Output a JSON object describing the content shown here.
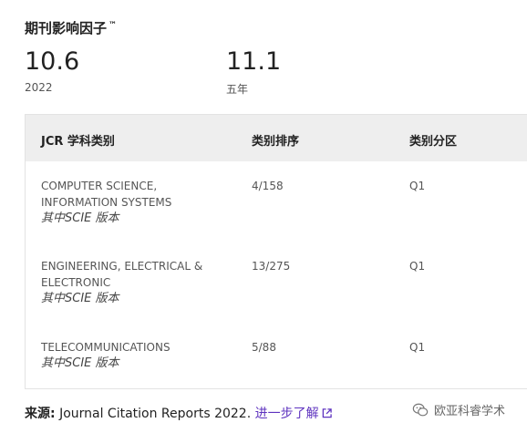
{
  "header": {
    "title": "期刊影响因子",
    "trademark": "™"
  },
  "metrics": [
    {
      "value": "10.6",
      "label": "2022"
    },
    {
      "value": "11.1",
      "label": "五年"
    }
  ],
  "table": {
    "columns": [
      "JCR 学科类别",
      "类别排序",
      "类别分区"
    ],
    "rows": [
      {
        "category_line1": "COMPUTER SCIENCE,",
        "category_line2": "INFORMATION SYSTEMS",
        "edition": "其中SCIE 版本",
        "rank": "4/158",
        "quartile": "Q1"
      },
      {
        "category_line1": "ENGINEERING, ELECTRICAL &",
        "category_line2": "ELECTRONIC",
        "edition": "其中SCIE 版本",
        "rank": "13/275",
        "quartile": "Q1"
      },
      {
        "category_line1": "TELECOMMUNICATIONS",
        "category_line2": "",
        "edition": "其中SCIE 版本",
        "rank": "5/88",
        "quartile": "Q1"
      }
    ]
  },
  "source": {
    "label": "来源:",
    "text": "Journal Citation Reports  2022.",
    "link": "进一步了解"
  },
  "watermark": {
    "text": "欧亚科睿学术"
  },
  "colors": {
    "link": "#5e33bf",
    "header_bg": "#eeeeee"
  }
}
